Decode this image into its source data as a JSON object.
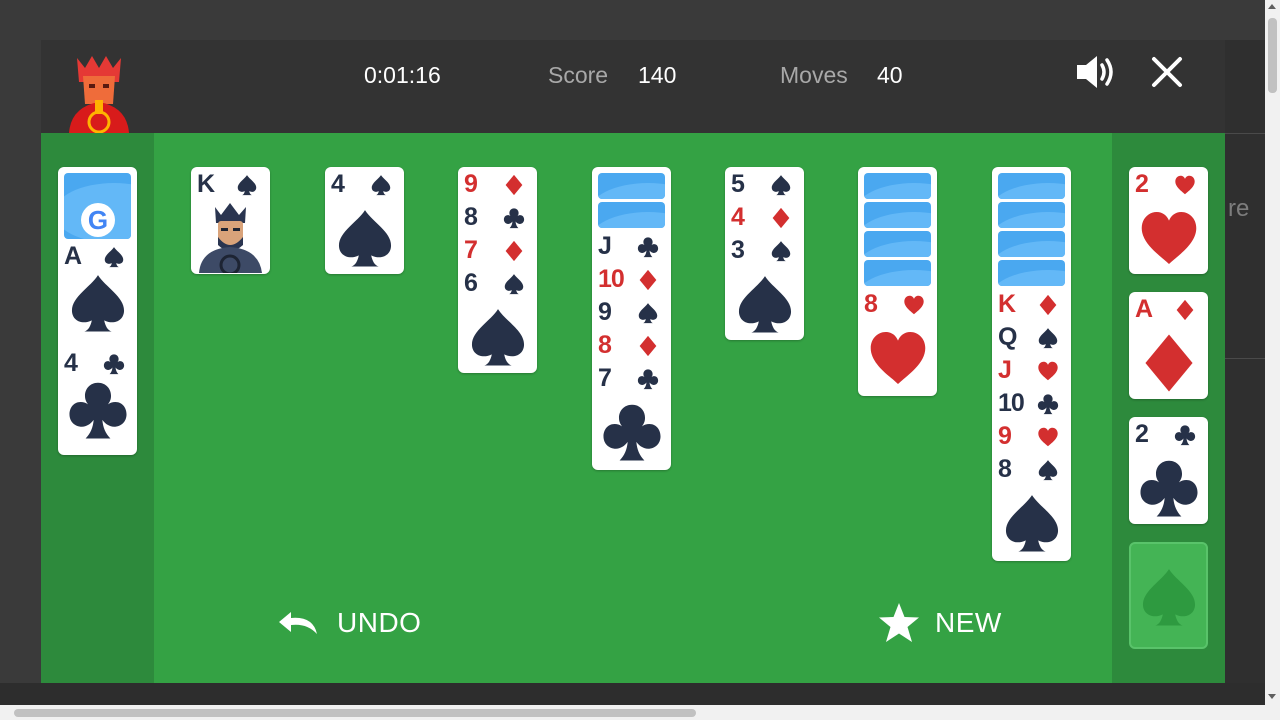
{
  "header": {
    "timer": "0:01:16",
    "score_label": "Score",
    "score_value": "140",
    "moves_label": "Moves",
    "moves_value": "40",
    "sound_icon": "volume-icon",
    "close_icon": "close-icon"
  },
  "background_text": "re",
  "controls": {
    "undo_label": "UNDO",
    "new_label": "NEW"
  },
  "colors": {
    "board_green": "#34a244",
    "side_green": "#2d8a3c",
    "topbar": "#333333",
    "red_suit": "#d32f2f",
    "black_suit": "#263148"
  },
  "waste_pile": {
    "top_back_logo": "G",
    "cards": [
      {
        "rank": "A",
        "suit": "spades"
      },
      {
        "rank": "4",
        "suit": "clubs"
      }
    ]
  },
  "tableau": [
    {
      "face_down": 0,
      "cards": [
        {
          "rank": "K",
          "suit": "spades",
          "face": "king"
        }
      ]
    },
    {
      "face_down": 0,
      "cards": [
        {
          "rank": "4",
          "suit": "spades"
        }
      ]
    },
    {
      "face_down": 0,
      "cards": [
        {
          "rank": "9",
          "suit": "diamonds"
        },
        {
          "rank": "8",
          "suit": "clubs"
        },
        {
          "rank": "7",
          "suit": "diamonds"
        },
        {
          "rank": "6",
          "suit": "spades"
        }
      ]
    },
    {
      "face_down": 2,
      "cards": [
        {
          "rank": "J",
          "suit": "clubs"
        },
        {
          "rank": "10",
          "suit": "diamonds"
        },
        {
          "rank": "9",
          "suit": "spades"
        },
        {
          "rank": "8",
          "suit": "diamonds"
        },
        {
          "rank": "7",
          "suit": "clubs"
        }
      ]
    },
    {
      "face_down": 0,
      "cards": [
        {
          "rank": "5",
          "suit": "spades"
        },
        {
          "rank": "4",
          "suit": "diamonds"
        },
        {
          "rank": "3",
          "suit": "spades"
        }
      ]
    },
    {
      "face_down": 4,
      "cards": [
        {
          "rank": "8",
          "suit": "hearts"
        }
      ]
    },
    {
      "face_down": 4,
      "cards": [
        {
          "rank": "K",
          "suit": "diamonds"
        },
        {
          "rank": "Q",
          "suit": "spades"
        },
        {
          "rank": "J",
          "suit": "hearts"
        },
        {
          "rank": "10",
          "suit": "clubs"
        },
        {
          "rank": "9",
          "suit": "hearts"
        },
        {
          "rank": "8",
          "suit": "spades"
        }
      ]
    }
  ],
  "foundations": [
    {
      "rank": "2",
      "suit": "hearts"
    },
    {
      "rank": "A",
      "suit": "diamonds"
    },
    {
      "rank": "2",
      "suit": "clubs"
    },
    {
      "empty": true,
      "suit": "spades"
    }
  ]
}
